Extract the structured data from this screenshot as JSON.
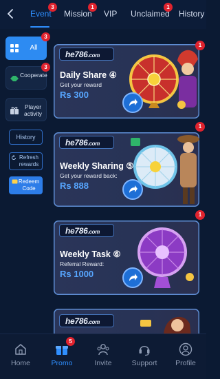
{
  "header": {
    "tabs": [
      {
        "label": "Event",
        "badge": "3",
        "active": true
      },
      {
        "label": "Mission",
        "badge": "1"
      },
      {
        "label": "VIP"
      },
      {
        "label": "Unclaimed",
        "badge": "1"
      },
      {
        "label": "History"
      }
    ]
  },
  "sidebar": {
    "items": [
      {
        "label": "All",
        "badge": "3",
        "active": true
      },
      {
        "label": "Cooperate",
        "badge": "3"
      },
      {
        "label": "Player activity"
      }
    ],
    "actions": [
      {
        "label": "History"
      },
      {
        "label": "Refresh rewards"
      },
      {
        "label": "Redeem Code"
      }
    ]
  },
  "cards": [
    {
      "brand": "he786",
      "brand_suffix": ".com",
      "title": "Daily Share ④",
      "subtitle": "Get your reward",
      "amount": "Rs 300",
      "badge": "1"
    },
    {
      "brand": "he786",
      "brand_suffix": ".com",
      "title": "Weekly Sharing ⑤",
      "subtitle": "Get your reward back:",
      "amount": "Rs 888",
      "badge": "1"
    },
    {
      "brand": "he786",
      "brand_suffix": ".com",
      "title": "Weekly Task ⑥",
      "subtitle": "Referral Reward:",
      "amount": "Rs 1000",
      "badge": "1"
    },
    {
      "brand": "he786",
      "brand_suffix": ".com"
    }
  ],
  "bottom_nav": {
    "items": [
      {
        "label": "Home",
        "icon": "home-icon"
      },
      {
        "label": "Promo",
        "icon": "gift-icon",
        "badge": "5",
        "active": true
      },
      {
        "label": "Invite",
        "icon": "invite-icon"
      },
      {
        "label": "Support",
        "icon": "headset-icon"
      },
      {
        "label": "Profile",
        "icon": "profile-icon"
      }
    ]
  },
  "colors": {
    "accent": "#2f8fff",
    "badge": "#e0232e",
    "background": "#0b1a33"
  }
}
